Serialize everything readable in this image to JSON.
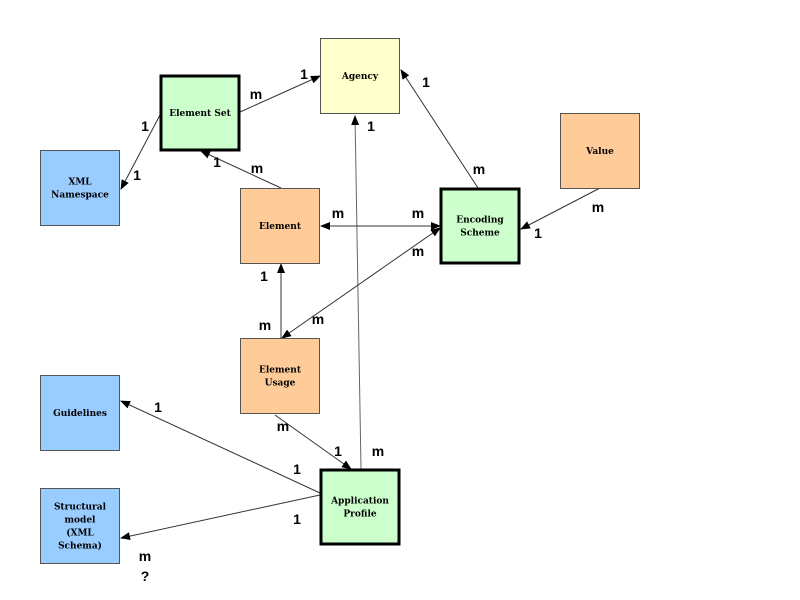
{
  "colors": {
    "green": "#ccffcc",
    "yellow": "#ffffcc",
    "blue": "#99ccff",
    "orange": "#ffcc99"
  },
  "nodes": [
    {
      "id": "agency",
      "lines": [
        "Agency"
      ],
      "color": "yellow",
      "thick": false
    },
    {
      "id": "element-set",
      "lines": [
        "Element Set"
      ],
      "color": "green",
      "thick": true
    },
    {
      "id": "xml-namespace",
      "lines": [
        "XML",
        "Namespace"
      ],
      "color": "blue",
      "thick": false
    },
    {
      "id": "element",
      "lines": [
        "Element"
      ],
      "color": "orange",
      "thick": false
    },
    {
      "id": "encoding-scheme",
      "lines": [
        "Encoding",
        "Scheme"
      ],
      "color": "green",
      "thick": true
    },
    {
      "id": "value",
      "lines": [
        "Value"
      ],
      "color": "orange",
      "thick": false
    },
    {
      "id": "element-usage",
      "lines": [
        "Element",
        "Usage"
      ],
      "color": "orange",
      "thick": false
    },
    {
      "id": "guidelines",
      "lines": [
        "Guidelines"
      ],
      "color": "blue",
      "thick": false
    },
    {
      "id": "structural-model",
      "lines": [
        "Structural",
        "model",
        "(XML",
        "Schema)"
      ],
      "color": "blue",
      "thick": false
    },
    {
      "id": "application-profile",
      "lines": [
        "Application",
        "Profile"
      ],
      "color": "green",
      "thick": true
    }
  ],
  "edges": [
    {
      "from": "element-set",
      "to": "agency",
      "labels": [
        "m",
        "1"
      ]
    },
    {
      "from": "element-set",
      "to": "xml-namespace",
      "labels": [
        "1",
        "1"
      ]
    },
    {
      "from": "element",
      "to": "element-set",
      "labels": [
        "m",
        "1"
      ]
    },
    {
      "from": "encoding-scheme",
      "to": "agency",
      "labels": [
        "m",
        "1"
      ]
    },
    {
      "from": "application-profile",
      "to": "agency",
      "labels": [
        "m",
        "1"
      ]
    },
    {
      "from": "encoding-scheme",
      "to": "element",
      "labels": [
        "m",
        "m"
      ],
      "both": true
    },
    {
      "from": "encoding-scheme",
      "to": "element-usage",
      "labels": [
        "m",
        "m"
      ],
      "both": true
    },
    {
      "from": "element-usage",
      "to": "element",
      "labels": [
        "m",
        "1"
      ]
    },
    {
      "from": "value",
      "to": "encoding-scheme",
      "labels": [
        "m",
        "1"
      ]
    },
    {
      "from": "element-usage",
      "to": "application-profile",
      "labels": [
        "m",
        "1"
      ]
    },
    {
      "from": "application-profile",
      "to": "guidelines",
      "labels": [
        "1",
        "1"
      ]
    },
    {
      "from": "application-profile",
      "to": "structural-model",
      "labels": [
        "1",
        "m",
        "?"
      ]
    }
  ]
}
